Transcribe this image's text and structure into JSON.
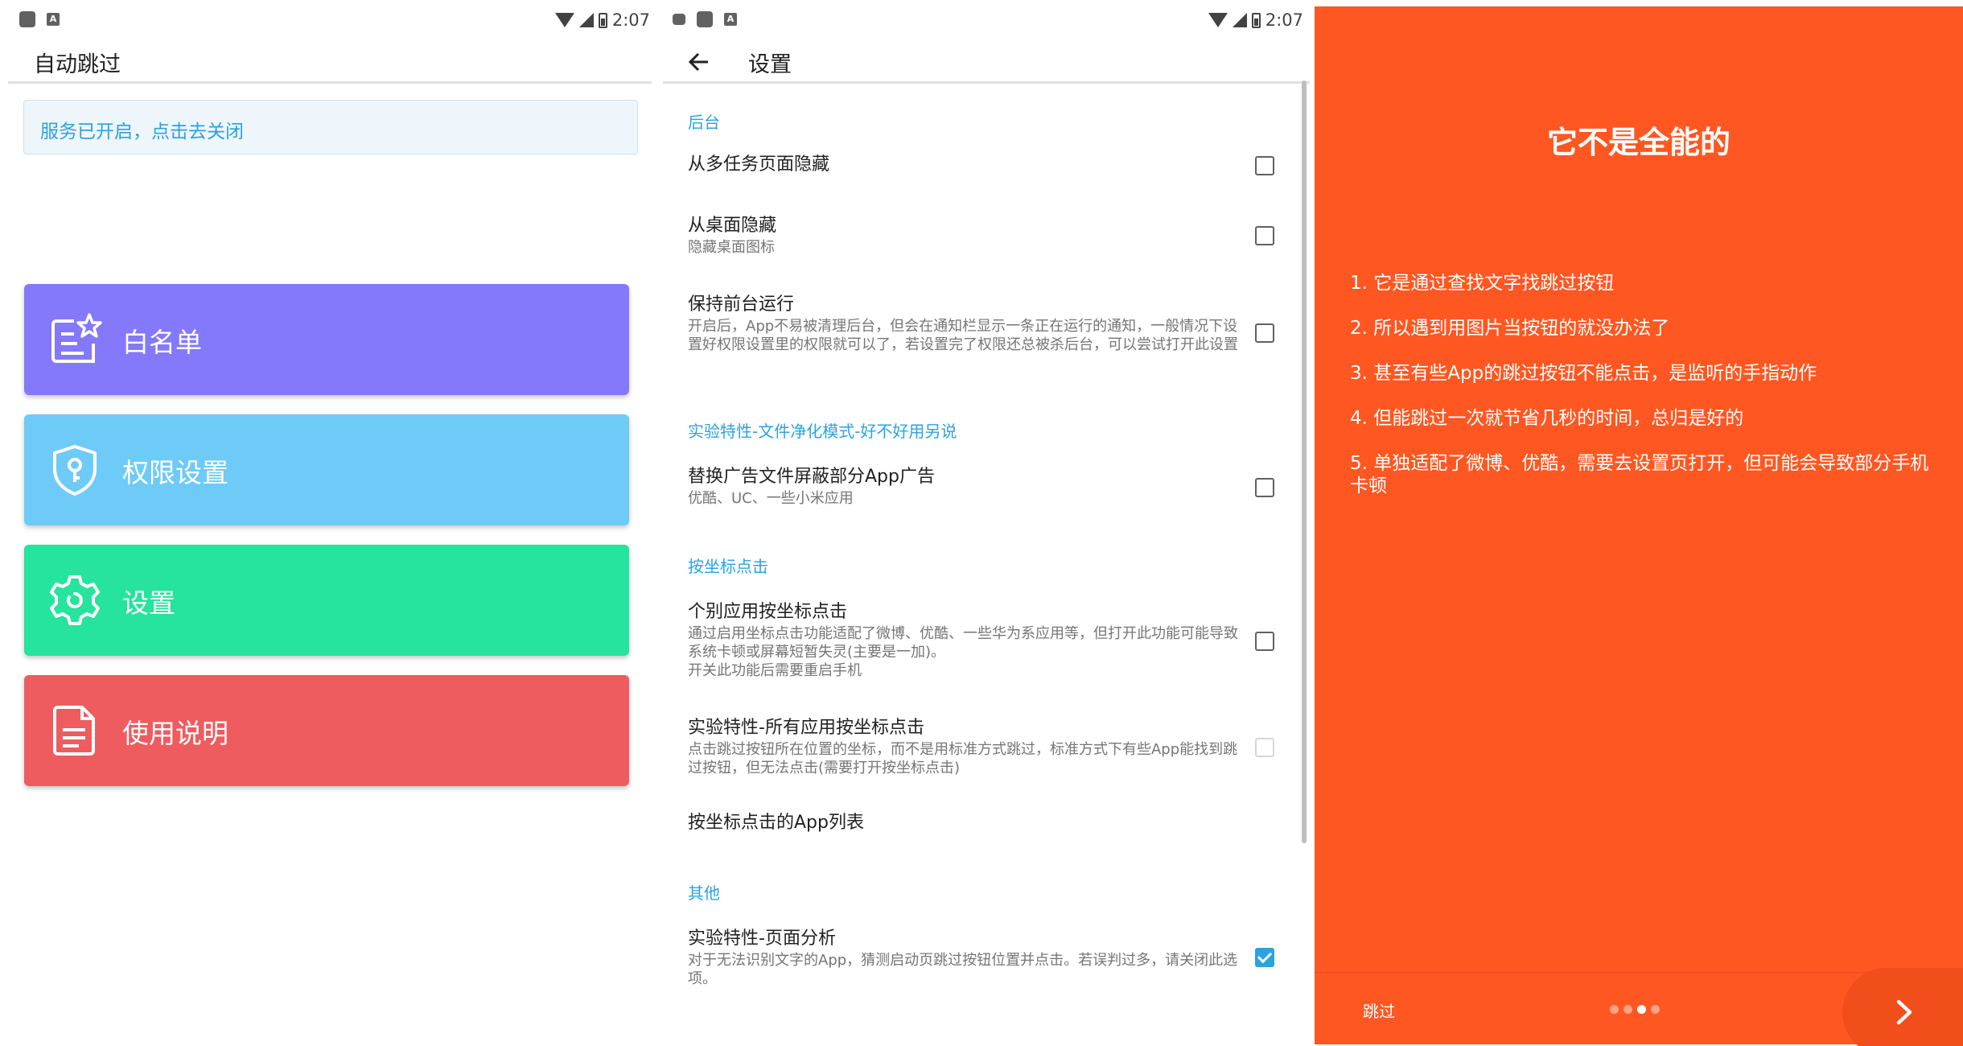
{
  "status": {
    "time": "2:07"
  },
  "main": {
    "title": "自动跳过",
    "service_text": "服务已开启，点击去关闭",
    "menu": [
      {
        "label": "白名单",
        "color": "#8479fb",
        "icon": "whitelist-icon"
      },
      {
        "label": "权限设置",
        "color": "#6ecbf7",
        "icon": "shield-key-icon"
      },
      {
        "label": "设置",
        "color": "#26e39d",
        "icon": "gear-icon"
      },
      {
        "label": "使用说明",
        "color": "#ee5c60",
        "icon": "document-icon"
      }
    ]
  },
  "settings": {
    "title": "设置",
    "categories": {
      "background": "后台",
      "experimental": "实验特性-文件净化模式-好不好用另说",
      "coordinate": "按坐标点击",
      "other": "其他"
    },
    "items": [
      {
        "title": "从多任务页面隐藏",
        "summary": "",
        "checked": false
      },
      {
        "title": "从桌面隐藏",
        "summary": "隐藏桌面图标",
        "checked": false
      },
      {
        "title": "保持前台运行",
        "summary": "开启后，App不易被清理后台，但会在通知栏显示一条正在运行的通知，一般情况下设置好权限设置里的权限就可以了，若设置完了权限还总被杀后台，可以尝试打开此设置",
        "checked": false
      },
      {
        "title": "替换广告文件屏蔽部分App广告",
        "summary": "优酷、UC、一些小米应用",
        "checked": false
      },
      {
        "title": "个别应用按坐标点击",
        "summary": "通过启用坐标点击功能适配了微博、优酷、一些华为系应用等，但打开此功能可能导致系统卡顿或屏幕短暂失灵(主要是一加)。\n开关此功能后需要重启手机",
        "checked": false
      },
      {
        "title": "实验特性-所有应用按坐标点击",
        "summary": "点击跳过按钮所在位置的坐标，而不是用标准方式跳过，标准方式下有些App能找到跳过按钮，但无法点击(需要打开按坐标点击)",
        "checked": false,
        "disabled": true
      },
      {
        "title": "按坐标点击的App列表",
        "summary": ""
      },
      {
        "title": "实验特性-页面分析",
        "summary": "对于无法识别文字的App，猜测启动页跳过按钮位置并点击。若误判过多，请关闭此选项。",
        "checked": true
      }
    ]
  },
  "intro": {
    "background": "#ff5722",
    "title": "它不是全能的",
    "items": [
      "1. 它是通过查找文字找跳过按钮",
      "2. 所以遇到用图片当按钮的就没办法了",
      "3. 甚至有些App的跳过按钮不能点击，是监听的手指动作",
      "4. 但能跳过一次就节省几秒的时间，总归是好的",
      "5. 单独适配了微博、优酷，需要去设置页打开，但可能会导致部分手机卡顿"
    ],
    "skip": "跳过",
    "page_dots": {
      "count": 4,
      "active": 3
    }
  }
}
